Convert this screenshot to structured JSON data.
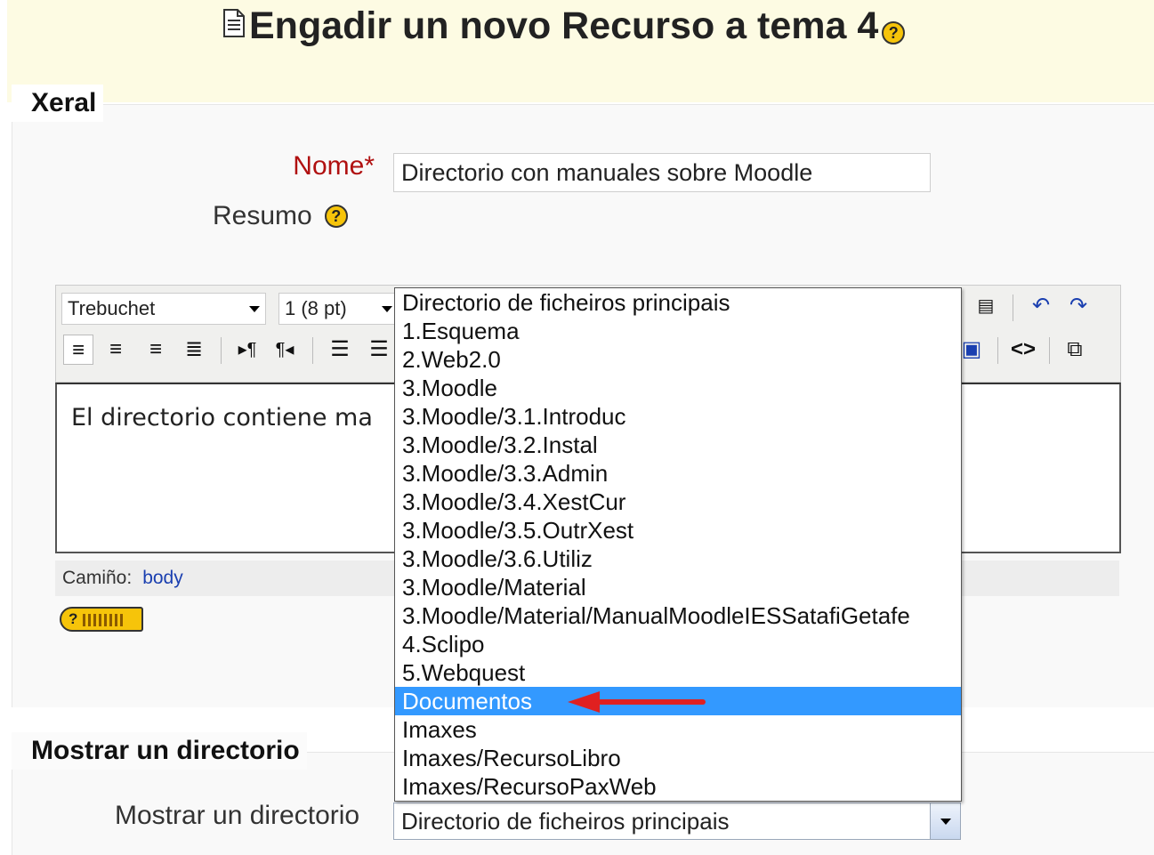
{
  "header": {
    "title": "Engadir un novo Recurso a tema 4"
  },
  "section_general": {
    "legend": "Xeral",
    "name_label": "Nome*",
    "name_value": "Directorio con manuales sobre Moodle",
    "summary_label": "Resumo"
  },
  "editor": {
    "font_select": "Trebuchet",
    "size_select": "1 (8 pt)",
    "content": "El directorio contiene ma",
    "path_label": "Camiño:",
    "path_value": "body"
  },
  "section_display": {
    "legend": "Mostrar un directorio",
    "label": "Mostrar un directorio",
    "selected": "Directorio de ficheiros principais"
  },
  "dropdown": {
    "options": [
      "Directorio de ficheiros principais",
      "1.Esquema",
      "2.Web2.0",
      "3.Moodle",
      "3.Moodle/3.1.Introduc",
      "3.Moodle/3.2.Instal",
      "3.Moodle/3.3.Admin",
      "3.Moodle/3.4.XestCur",
      "3.Moodle/3.5.OutrXest",
      "3.Moodle/3.6.Utiliz",
      "3.Moodle/Material",
      "3.Moodle/Material/ManualMoodleIESSatafiGetafe",
      "4.Sclipo",
      "5.Webquest",
      "Documentos",
      "Imaxes",
      "Imaxes/RecursoLibro",
      "Imaxes/RecursoPaxWeb"
    ],
    "highlighted": "Documentos"
  },
  "colors": {
    "highlight": "#3399ff",
    "arrow": "#e02020",
    "required": "#b01010",
    "help_icon": "#f6c40a"
  }
}
